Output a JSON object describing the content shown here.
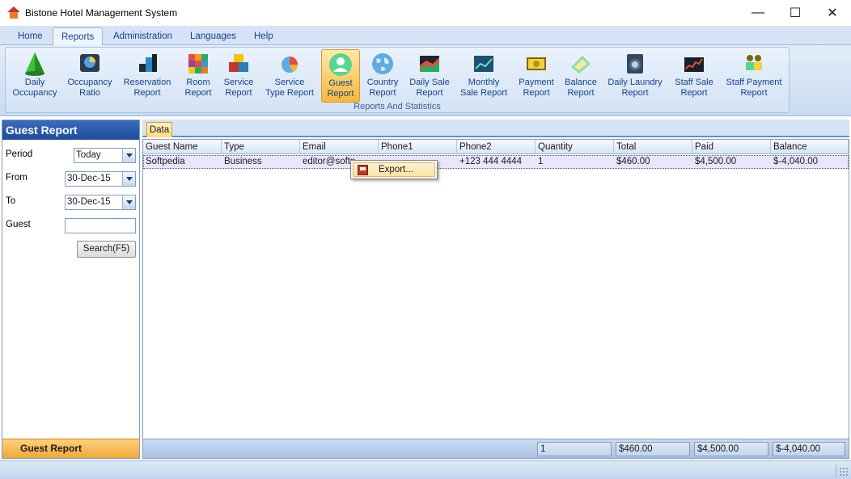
{
  "window": {
    "title": "Bistone Hotel Management System",
    "minimize": "—",
    "maximize": "☐",
    "close": "✕"
  },
  "menu": {
    "tabs": [
      "Home",
      "Reports",
      "Administration",
      "Languages",
      "Help"
    ],
    "active": "Reports"
  },
  "ribbon": {
    "group_label": "Reports And Statistics",
    "buttons": [
      {
        "label": "Daily\nOccupancy",
        "icon": "pyramid-icon"
      },
      {
        "label": "Occupancy\nRatio",
        "icon": "pie-chart-icon"
      },
      {
        "label": "Reservation\nReport",
        "icon": "blocks-icon"
      },
      {
        "label": "Room\nReport",
        "icon": "cubes-icon"
      },
      {
        "label": "Service\nReport",
        "icon": "boxes-icon"
      },
      {
        "label": "Service\nType Report",
        "icon": "chart-icon"
      },
      {
        "label": "Guest\nReport",
        "icon": "guest-icon",
        "active": true
      },
      {
        "label": "Country\nReport",
        "icon": "globe-icon"
      },
      {
        "label": "Daily Sale\nReport",
        "icon": "area-chart-icon"
      },
      {
        "label": "Monthly\nSale Report",
        "icon": "line-chart-icon"
      },
      {
        "label": "Payment\nReport",
        "icon": "money-icon"
      },
      {
        "label": "Balance\nReport",
        "icon": "calculator-icon"
      },
      {
        "label": "Daily Laundry\nReport",
        "icon": "washer-icon"
      },
      {
        "label": "Staff Sale\nReport",
        "icon": "stock-chart-icon"
      },
      {
        "label": "Staff Payment\nReport",
        "icon": "staff-money-icon"
      }
    ]
  },
  "left_panel": {
    "title": "Guest Report",
    "period_label": "Period",
    "period_value": "Today",
    "from_label": "From",
    "from_value": "30-Dec-15",
    "to_label": "To",
    "to_value": "30-Dec-15",
    "guest_label": "Guest",
    "guest_value": "",
    "search_button": "Search(F5)",
    "footer_label": "Guest Report"
  },
  "data_tab": "Data",
  "grid": {
    "columns": [
      "Guest Name",
      "Type",
      "Email",
      "Phone1",
      "Phone2",
      "Quantity",
      "Total",
      "Paid",
      "Balance"
    ],
    "rows": [
      [
        "Softpedia",
        "Business",
        "editor@softp",
        "",
        "+123 444 4444",
        "1",
        "$460.00",
        "$4,500.00",
        "$-4,040.00"
      ]
    ],
    "footer": {
      "quantity": "1",
      "total": "$460.00",
      "paid": "$4,500.00",
      "balance": "$-4,040.00"
    }
  },
  "context_menu": {
    "items": [
      "Export..."
    ]
  },
  "colors": {
    "accent": "#15428b",
    "ribbon_bg": "#d3e2f5",
    "active_orange": "#f7b73a",
    "header_blue": "#1f4c9a"
  }
}
